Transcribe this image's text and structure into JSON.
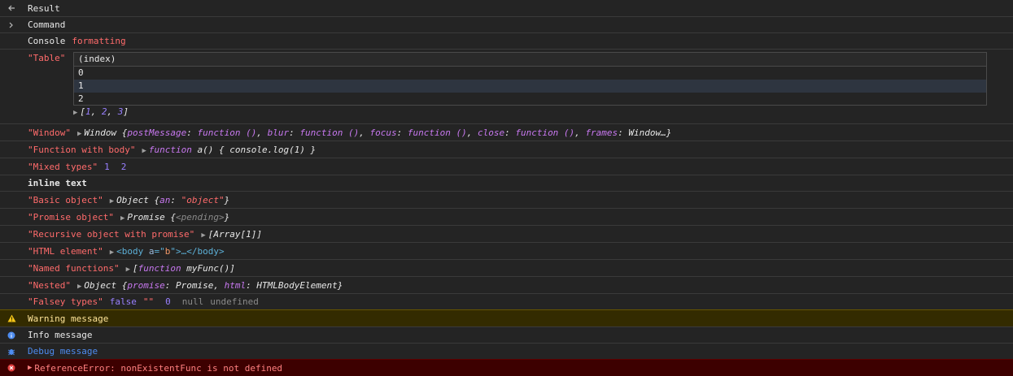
{
  "rows": {
    "result": "Result",
    "command": "Command",
    "console_label": "Console",
    "console_formatting": "formatting",
    "table_label": "\"Table\"",
    "table_header": "(index)",
    "table_rows": [
      "0",
      "1",
      "2"
    ],
    "array_open": "[",
    "array_vals": [
      "1",
      "2",
      "3"
    ],
    "array_close": "]",
    "window_label": "\"Window\"",
    "window_prefix": "Window {",
    "window_props": [
      {
        "k": "postMessage",
        "v": "function ()"
      },
      {
        "k": "blur",
        "v": "function ()"
      },
      {
        "k": "focus",
        "v": "function ()"
      },
      {
        "k": "close",
        "v": "function ()"
      },
      {
        "k": "frames",
        "v": "Window…"
      }
    ],
    "window_suffix": "}",
    "fn_label": "\"Function with body\"",
    "fn_keyword": "function",
    "fn_body": "a() { console.log(1) }",
    "mixed_label": "\"Mixed types\"",
    "mixed_vals": [
      "1",
      "2"
    ],
    "inline_text": "inline text",
    "basic_label": "\"Basic object\"",
    "basic_prefix": "Object {",
    "basic_key": "an",
    "basic_val": "\"object\"",
    "basic_suffix": "}",
    "promise_label": "\"Promise object\"",
    "promise_prefix": "Promise {",
    "promise_state": "<pending>",
    "promise_suffix": "}",
    "recursive_label": "\"Recursive object with promise\"",
    "recursive_val": "[Array[1]]",
    "html_label": "\"HTML element\"",
    "html_open": "<body",
    "html_attr": "a",
    "html_eq": "=\"",
    "html_attrval": "b",
    "html_close": "\">…</body>",
    "named_label": "\"Named functions\"",
    "named_open": "[",
    "named_keyword": "function",
    "named_name": "myFunc()",
    "named_close": "]",
    "nested_label": "\"Nested\"",
    "nested_prefix": "Object {",
    "nested_k1": "promise",
    "nested_v1": "Promise,",
    "nested_k2": "html",
    "nested_v2": "HTMLBodyElement",
    "nested_suffix": "}",
    "falsey_label": "\"Falsey types\"",
    "falsey_false": "false",
    "falsey_empty": "\"\"",
    "falsey_zero": "0",
    "falsey_null": "null",
    "falsey_undef": "undefined",
    "warning": "Warning message",
    "info": "Info message",
    "debug": "Debug message",
    "error": "ReferenceError: nonExistentFunc is not defined"
  },
  "icons": {
    "result": "arrow-left-icon",
    "command": "chevron-right-icon",
    "warning": "warning-triangle-icon",
    "info": "info-circle-icon",
    "debug": "bug-icon",
    "error": "error-circle-icon"
  },
  "colors": {
    "background": "#242424",
    "warning_bg": "#332b00",
    "error_bg": "#3d0000",
    "string_red": "#ff6b6b",
    "keyword_purple": "#c878f0",
    "number_blue": "#9980ff",
    "debug_blue": "#4e8cf0"
  }
}
